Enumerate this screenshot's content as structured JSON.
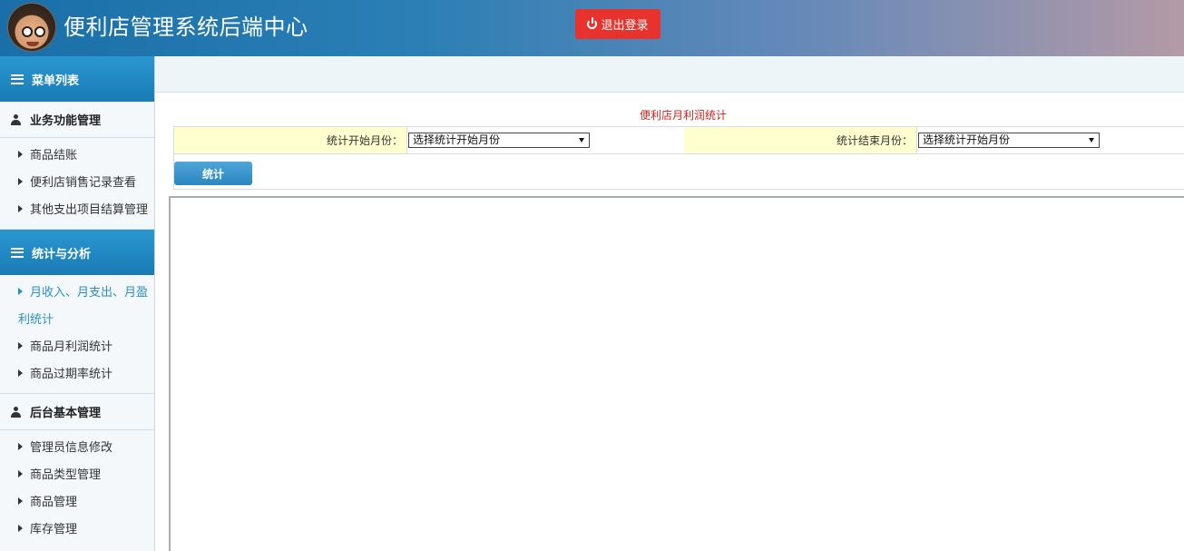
{
  "header": {
    "app_title": "便利店管理系统后端中心",
    "logout_label": "退出登录",
    "logout_color": "#e8322e"
  },
  "sidebar": {
    "menu_title": "菜单列表",
    "groups": [
      {
        "title": "业务功能管理",
        "items": [
          {
            "label": "商品结账"
          },
          {
            "label": "便利店销售记录查看"
          },
          {
            "label": "其他支出项目结算管理"
          }
        ]
      },
      {
        "title": "统计与分析",
        "items": [
          {
            "label": "月收入、月支出、月盈",
            "label_cont": "利统计",
            "active": true
          },
          {
            "label": "商品月利润统计"
          },
          {
            "label": "商品过期率统计"
          }
        ]
      },
      {
        "title": "后台基本管理",
        "items": [
          {
            "label": "管理员信息修改"
          },
          {
            "label": "商品类型管理"
          },
          {
            "label": "商品管理"
          },
          {
            "label": "库存管理"
          }
        ]
      }
    ]
  },
  "main": {
    "report_title": "便利店月利润统计",
    "start_label": "统计开始月份：",
    "start_select_value": "选择统计开始月份",
    "end_label": "统计结束月份：",
    "end_select_value": "选择统计开始月份",
    "submit_label": "统计"
  },
  "colors": {
    "accent": "#2a8fc6",
    "label_bg": "#ffffd0",
    "title_red": "#d0231f"
  }
}
